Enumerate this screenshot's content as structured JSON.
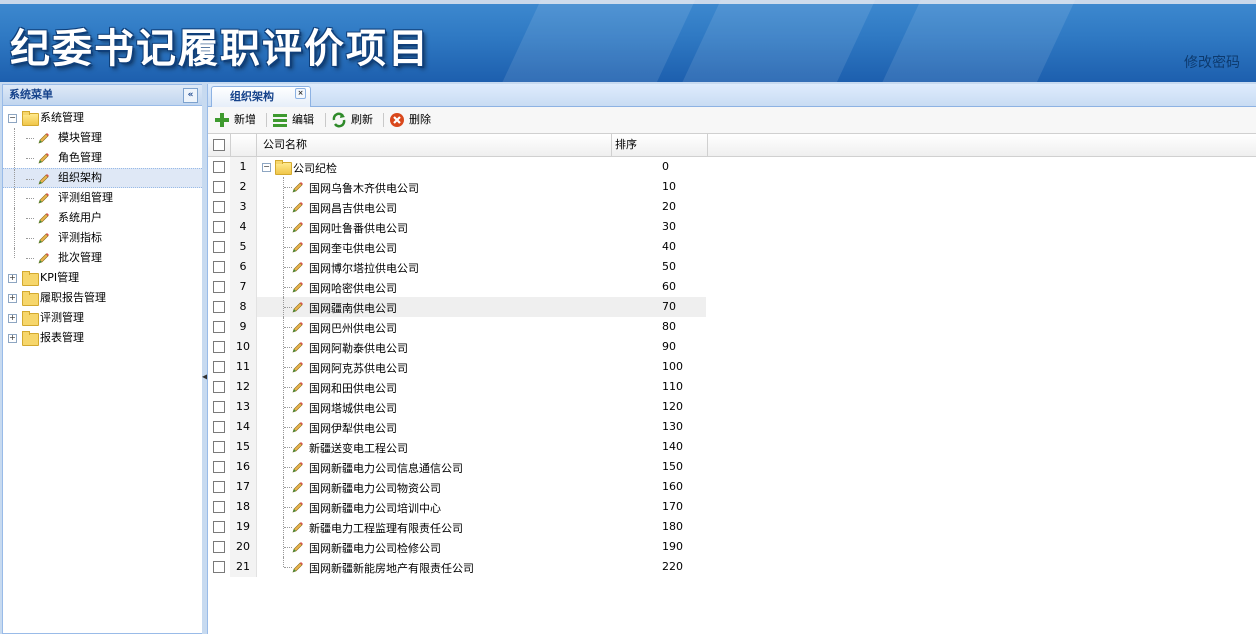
{
  "header": {
    "title": "纪委书记履职评价项目",
    "change_password": "修改密码"
  },
  "sidebar": {
    "title": "系统菜单",
    "collapse_glyph": "«",
    "groups": [
      {
        "label": "系统管理",
        "expanded": true,
        "items": [
          "模块管理",
          "角色管理",
          "组织架构",
          "评测组管理",
          "系统用户",
          "评测指标",
          "批次管理"
        ],
        "selected_index": 2
      },
      {
        "label": "KPI管理",
        "expanded": false
      },
      {
        "label": "履职报告管理",
        "expanded": false
      },
      {
        "label": "评测管理",
        "expanded": false
      },
      {
        "label": "报表管理",
        "expanded": false
      }
    ]
  },
  "tab": {
    "label": "组织架构",
    "close_glyph": "×"
  },
  "toolbar": {
    "add": "新增",
    "edit": "编辑",
    "refresh": "刷新",
    "delete": "删除"
  },
  "grid": {
    "columns": {
      "name": "公司名称",
      "order": "排序"
    },
    "root": {
      "num": "1",
      "name": "公司纪检",
      "order": "0"
    },
    "highlight_index": 6,
    "rows": [
      {
        "num": "2",
        "name": "国网乌鲁木齐供电公司",
        "order": "10"
      },
      {
        "num": "3",
        "name": "国网昌吉供电公司",
        "order": "20"
      },
      {
        "num": "4",
        "name": "国网吐鲁番供电公司",
        "order": "30"
      },
      {
        "num": "5",
        "name": "国网奎屯供电公司",
        "order": "40"
      },
      {
        "num": "6",
        "name": "国网博尔塔拉供电公司",
        "order": "50"
      },
      {
        "num": "7",
        "name": "国网哈密供电公司",
        "order": "60"
      },
      {
        "num": "8",
        "name": "国网疆南供电公司",
        "order": "70"
      },
      {
        "num": "9",
        "name": "国网巴州供电公司",
        "order": "80"
      },
      {
        "num": "10",
        "name": "国网阿勒泰供电公司",
        "order": "90"
      },
      {
        "num": "11",
        "name": "国网阿克苏供电公司",
        "order": "100"
      },
      {
        "num": "12",
        "name": "国网和田供电公司",
        "order": "110"
      },
      {
        "num": "13",
        "name": "国网塔城供电公司",
        "order": "120"
      },
      {
        "num": "14",
        "name": "国网伊犁供电公司",
        "order": "130"
      },
      {
        "num": "15",
        "name": "新疆送变电工程公司",
        "order": "140"
      },
      {
        "num": "16",
        "name": "国网新疆电力公司信息通信公司",
        "order": "150"
      },
      {
        "num": "17",
        "name": "国网新疆电力公司物资公司",
        "order": "160"
      },
      {
        "num": "18",
        "name": "国网新疆电力公司培训中心",
        "order": "170"
      },
      {
        "num": "19",
        "name": "新疆电力工程监理有限责任公司",
        "order": "180"
      },
      {
        "num": "20",
        "name": "国网新疆电力公司检修公司",
        "order": "190"
      },
      {
        "num": "21",
        "name": "国网新疆新能房地产有限责任公司",
        "order": "220"
      }
    ]
  }
}
